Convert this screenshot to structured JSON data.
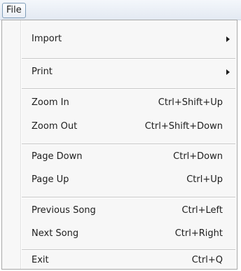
{
  "menubar": {
    "file_label": "File"
  },
  "menu": {
    "items": [
      {
        "label": "Import",
        "shortcut": "",
        "submenu": true
      },
      {
        "label": "Print",
        "shortcut": "",
        "submenu": true
      },
      {
        "label": "Zoom In",
        "shortcut": "Ctrl+Shift+Up",
        "submenu": false
      },
      {
        "label": "Zoom Out",
        "shortcut": "Ctrl+Shift+Down",
        "submenu": false
      },
      {
        "label": "Page Down",
        "shortcut": "Ctrl+Down",
        "submenu": false
      },
      {
        "label": "Page Up",
        "shortcut": "Ctrl+Up",
        "submenu": false
      },
      {
        "label": "Previous Song",
        "shortcut": "Ctrl+Left",
        "submenu": false
      },
      {
        "label": "Next Song",
        "shortcut": "Ctrl+Right",
        "submenu": false
      },
      {
        "label": "Exit",
        "shortcut": "Ctrl+Q",
        "submenu": false
      }
    ]
  }
}
